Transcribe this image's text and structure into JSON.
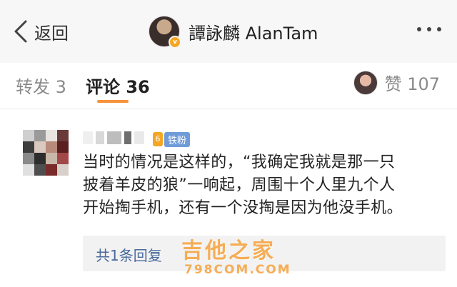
{
  "header": {
    "back_label": "返回",
    "title": "譚詠麟 AlanTam"
  },
  "tabs": {
    "repost": "转发 3",
    "comment": "评论 36",
    "like": "赞 107"
  },
  "comment": {
    "badge_label": "铁粉",
    "lines": [
      "当时的情况是这样的，“我确定我就是那一只",
      "披着羊皮的狼”一响起，周围十个人里九个人",
      "开始掏手机，还有一个没掏是因为他没手机。"
    ],
    "replies_label": "共1条回复"
  },
  "watermark": {
    "main": "吉他之家",
    "sub": "798COM.COM"
  },
  "colors": {
    "accent": "#f7923b",
    "link": "#4a6a9b",
    "header_bg": "#f7f7f7",
    "badge_blue": "#6f9bd8"
  }
}
